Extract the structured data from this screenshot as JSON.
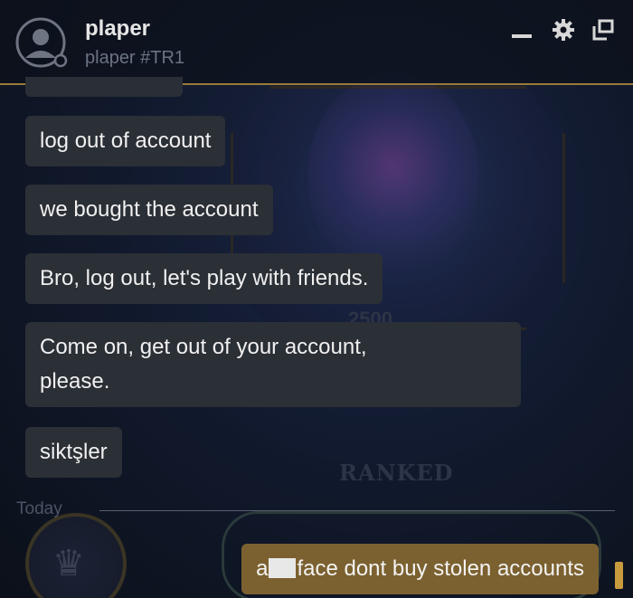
{
  "header": {
    "username": "plaper",
    "tagline": "plaper #TR1",
    "icons": [
      "minimize-icon",
      "gear-icon",
      "popout-icon"
    ]
  },
  "background": {
    "ranked_label": "RANKED",
    "score": "2500"
  },
  "messages": [
    {
      "text": "log out of account",
      "from": "other"
    },
    {
      "text": "we bought the account",
      "from": "other"
    },
    {
      "text": "Bro, log out, let's play with friends.",
      "from": "other"
    },
    {
      "text_line1": "Come on, get out of your account,",
      "text_line2": "please.",
      "from": "other"
    },
    {
      "text": "siktşler",
      "from": "other"
    }
  ],
  "divider": {
    "label": "Today"
  },
  "self_message": {
    "prefix": "a",
    "suffix": "face dont buy stolen accounts"
  },
  "colors": {
    "accent_gold": "#9a7a3a",
    "self_bubble": "#7c6130",
    "other_bubble": "#2b2f36"
  }
}
